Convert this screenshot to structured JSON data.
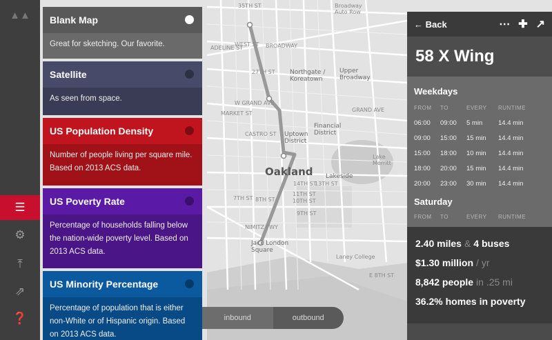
{
  "map": {
    "labels": [
      "35TH ST",
      "Broadway Auto Row",
      "27TH ST",
      "Northgate / Koreatown",
      "Upper Broadway",
      "W GRAND AVE",
      "Uptown District",
      "Financial District",
      "Oakland",
      "Lakeside",
      "Lake Merritt",
      "Jack London Square",
      "Laney College",
      "14TH ST",
      "13TH ST",
      "11TH ST",
      "10TH ST",
      "9TH ST",
      "8TH ST",
      "7TH ST",
      "NIMITZ FWY",
      "MARKET ST",
      "BROADWAY",
      "CASTRO ST",
      "ADELINE ST",
      "WEST ST",
      "GRAND AVE",
      "E 8TH ST"
    ],
    "accent_route": "#999999"
  },
  "iconbar": {
    "items": [
      "logo-icon",
      "layers-icon",
      "gear-icon",
      "upload-icon",
      "export-icon",
      "help-icon"
    ]
  },
  "layers": [
    {
      "title": "Blank Map",
      "desc": "Great for sketching. Our favorite.",
      "color": "#595959",
      "selected": true
    },
    {
      "title": "Satellite",
      "desc": "As seen from space.",
      "color": "#474a68",
      "selected": false
    },
    {
      "title": "US Population Density",
      "desc": "Number of people living per square mile. Based on 2013 ACS data.",
      "color": "#c0141e",
      "selected": false
    },
    {
      "title": "US Poverty Rate",
      "desc": "Percentage of households falling below the nation-wide poverty level. Based on 2013 ACS data.",
      "color": "#5b1aa6",
      "selected": false
    },
    {
      "title": "US Minority Percentage",
      "desc": "Percentage of population that is either non-White or of Hispanic origin. Based on 2013 ACS data.",
      "color": "#0b5aa0",
      "selected": false
    }
  ],
  "direction_toggle": {
    "inbound": "inbound",
    "outbound": "outbound"
  },
  "route": {
    "back": "Back",
    "name": "58 X Wing",
    "weekdays": "Weekdays",
    "saturday": "Saturday",
    "columns": [
      "FROM",
      "TO",
      "EVERY",
      "RUNTIME"
    ],
    "weekday_rows": [
      [
        "06:00",
        "09:00",
        "5 min",
        "14.4 min"
      ],
      [
        "09:00",
        "15:00",
        "15 min",
        "14.4 min"
      ],
      [
        "15:00",
        "18:00",
        "10 min",
        "14.4 min"
      ],
      [
        "18:00",
        "20:00",
        "15 min",
        "14.4 min"
      ],
      [
        "20:00",
        "23:00",
        "30 min",
        "14.4 min"
      ]
    ],
    "stats": {
      "miles": "2.40 miles",
      "amp": "&",
      "buses": "4 buses",
      "cost": "$1.30 million",
      "cost_unit": "/ yr",
      "people": "8,842 people",
      "people_unit": "in .25 mi",
      "poverty": "36.2% homes in poverty"
    }
  }
}
